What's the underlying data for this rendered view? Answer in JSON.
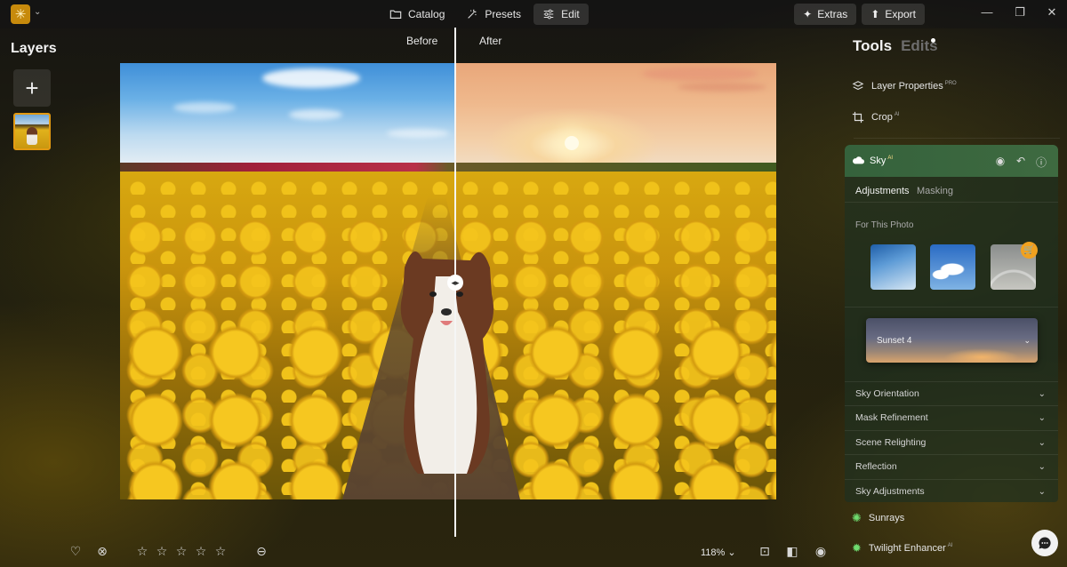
{
  "topbar": {
    "nav": [
      {
        "label": "Catalog",
        "icon": "folder-icon"
      },
      {
        "label": "Presets",
        "icon": "presets-icon"
      },
      {
        "label": "Edit",
        "icon": "sliders-icon"
      }
    ],
    "extras_label": "Extras",
    "export_label": "Export"
  },
  "layers": {
    "title": "Layers"
  },
  "compare": {
    "before": "Before",
    "after": "After"
  },
  "bottom": {
    "zoom": "118%"
  },
  "panel": {
    "tab_tools": "Tools",
    "tab_edits": "Edits",
    "tools": [
      {
        "label": "Layer Properties",
        "badge": "PRO"
      },
      {
        "label": "Crop",
        "badge": "AI"
      }
    ],
    "sky": {
      "title": "Sky",
      "badge": "AI",
      "subtabs": [
        "Adjustments",
        "Masking"
      ],
      "for_photo": "For This Photo",
      "selected_sky": "Sunset 4",
      "accordions": [
        "Sky Orientation",
        "Mask Refinement",
        "Scene Relighting",
        "Reflection",
        "Sky Adjustments"
      ]
    },
    "extras": [
      {
        "label": "Sunrays",
        "badge": ""
      },
      {
        "label": "Twilight Enhancer",
        "badge": "AI"
      }
    ]
  },
  "colors": {
    "accent": "#e39a12",
    "sky_header": "#3e6a40"
  }
}
